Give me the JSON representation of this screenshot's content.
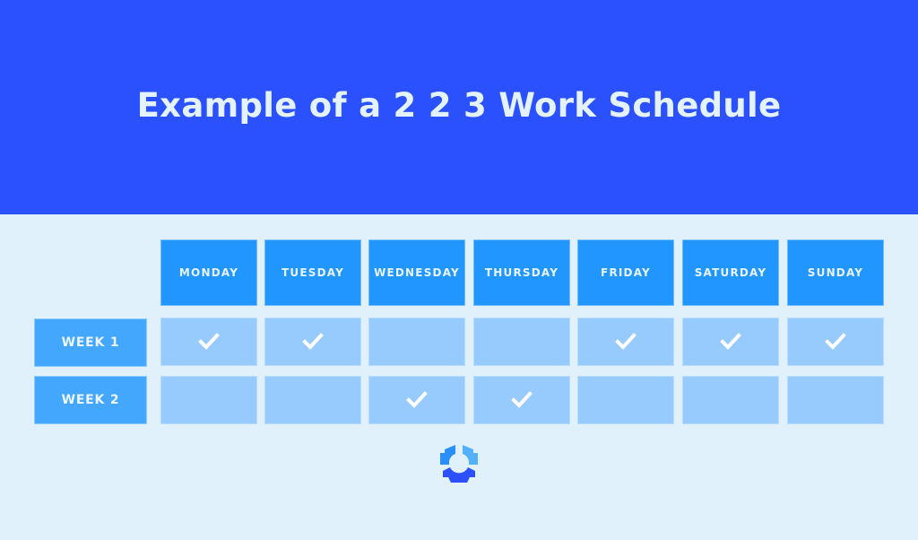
{
  "title": "Example of a 2 2 3 Work Schedule",
  "colors": {
    "banner": "#2b51fe",
    "background": "#e1f1fb",
    "day_header": "#2196fe",
    "week_label": "#43a7fe",
    "cell": "#97cbfd",
    "check": "#ffffff"
  },
  "days": [
    "MONDAY",
    "TUESDAY",
    "WEDNESDAY",
    "THURSDAY",
    "FRIDAY",
    "SATURDAY",
    "SUNDAY"
  ],
  "weeks": [
    {
      "label": "WEEK 1",
      "worked": [
        true,
        true,
        false,
        false,
        true,
        true,
        true
      ]
    },
    {
      "label": "WEEK 2",
      "worked": [
        false,
        false,
        true,
        true,
        false,
        false,
        false
      ]
    }
  ],
  "icons": {
    "check": "check-icon",
    "logo": "brand-logo-icon"
  }
}
